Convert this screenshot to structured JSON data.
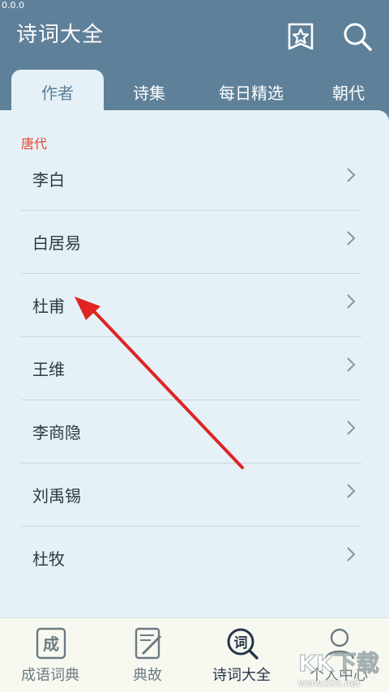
{
  "status": {
    "text": "0.0.0"
  },
  "header": {
    "title": "诗词大全",
    "favorite_icon": "star-bookmark-icon",
    "search_icon": "search-icon"
  },
  "tabs": [
    {
      "label": "作者",
      "active": true
    },
    {
      "label": "诗集",
      "active": false
    },
    {
      "label": "每日精选",
      "active": false
    },
    {
      "label": "朝代",
      "active": false
    }
  ],
  "section": {
    "label": "唐代",
    "color": "#e2462f"
  },
  "authors": [
    {
      "name": "李白"
    },
    {
      "name": "白居易"
    },
    {
      "name": "杜甫"
    },
    {
      "name": "王维"
    },
    {
      "name": "李商隐"
    },
    {
      "name": "刘禹锡"
    },
    {
      "name": "杜牧"
    }
  ],
  "annotation": {
    "type": "red-arrow",
    "color": "#e02424",
    "points_to": "杜甫"
  },
  "bottom_nav": [
    {
      "label": "成语词典",
      "icon": "idiom-book-icon",
      "active": false
    },
    {
      "label": "典故",
      "icon": "document-pen-icon",
      "active": false
    },
    {
      "label": "诗词大全",
      "icon": "poetry-search-icon",
      "active": true
    },
    {
      "label": "个人中心",
      "icon": "person-icon",
      "active": false
    }
  ],
  "watermark": {
    "text": "www.kkx.net",
    "logo": "KK下载"
  },
  "colors": {
    "header_bg": "#5f8099",
    "panel_bg": "#e5f1f6",
    "nav_bg": "#f7f9f1",
    "active_tab_text": "#5d7f98"
  }
}
